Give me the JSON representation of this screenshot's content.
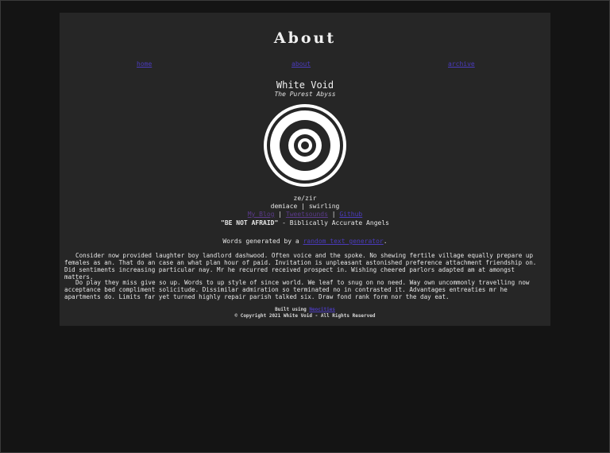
{
  "page": {
    "title": "About"
  },
  "nav": {
    "home": "home",
    "about": "about",
    "archive": "archive"
  },
  "site": {
    "name": "White Void",
    "tagline": "The Purest Abyss"
  },
  "profile": {
    "pronouns": "ze/zir",
    "neo_1": "demiace",
    "neo_sep": " | ",
    "neo_2": "swirling",
    "link_1": "My Blog",
    "link_sep_1": " | ",
    "link_2": "Tweetsounds",
    "link_sep_2": " | ",
    "link_3": "Github",
    "quote_bold": "\"BE NOT AFRAID\"",
    "quote_rest": " - Biblically Accurate Angels"
  },
  "credit": {
    "prefix": "Words generated by a ",
    "link": "random text generator",
    "suffix": "."
  },
  "body": {
    "paragraph_1": "Consider now provided laughter boy landlord dashwood. Often voice and the spoke. No shewing fertile village equally prepare up females as an. That do an case an what plan hour of paid. Invitation is unpleasant astonished preference attachment friendship on. Did sentiments increasing particular nay. Mr he recurred received prospect in. Wishing cheered parlors adapted am at amongst matters.",
    "paragraph_2": "Do play they miss give so up. Words to up style of since world. We leaf to snug on no need. Way own uncommonly travelling now acceptance bed compliment solicitude. Dissimilar admiration so terminated no in contrasted it. Advantages entreaties mr he apartments do. Limits far yet turned highly repair parish talked six. Draw fond rank form nor the day eat."
  },
  "footer": {
    "built_prefix": "Built using ",
    "built_link": "Neocities",
    "copyright": "© Copyright 2021 White Void - All Rights Reserved"
  },
  "colors": {
    "background": "#141414",
    "card": "#262626",
    "link": "#4b3bbd",
    "text": "#e6e6e6"
  }
}
